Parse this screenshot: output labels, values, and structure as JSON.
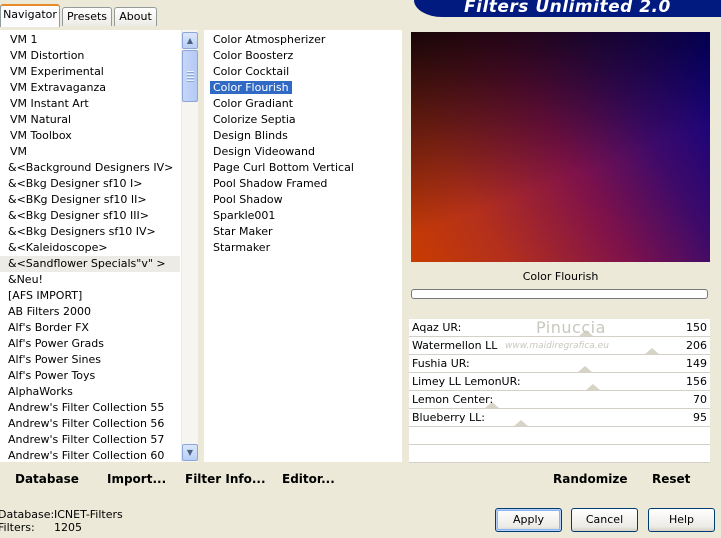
{
  "window": {
    "title": "Filters Unlimited 2.0"
  },
  "tabs": [
    {
      "label": "Navigator",
      "active": true
    },
    {
      "label": "Presets",
      "active": false
    },
    {
      "label": "About",
      "active": false
    }
  ],
  "categories": [
    "VM 1",
    "VM Distortion",
    "VM Experimental",
    "VM Extravaganza",
    "VM Instant Art",
    "VM Natural",
    "VM Toolbox",
    "VM",
    "&<Background Designers IV>",
    "&<Bkg Designer sf10 I>",
    "&<BKg Designer sf10 II>",
    "&<Bkg Designer sf10 III>",
    "&<Bkg Designers sf10 IV>",
    "&<Kaleidoscope>",
    "&<Sandflower Specials\"v\" >",
    "&Neu!",
    "[AFS IMPORT]",
    "AB Filters 2000",
    "Alf's Border FX",
    "Alf's Power Grads",
    "Alf's Power Sines",
    "Alf's Power Toys",
    "AlphaWorks",
    "Andrew's Filter Collection 55",
    "Andrew's Filter Collection 56",
    "Andrew's Filter Collection 57",
    "Andrew's Filter Collection 60"
  ],
  "selected_category": "&<Sandflower Specials\"v\" >",
  "filters": [
    "Color Atmospherizer",
    "Color Boosterz",
    "Color Cocktail",
    "Color Flourish",
    "Color Gradiant",
    "Colorize Septia",
    "Design Blinds",
    "Design Videowand",
    "Page Curl Bottom Vertical",
    "Pool Shadow Framed",
    "Pool Shadow",
    "Sparkle001",
    "Star Maker",
    "Starmaker"
  ],
  "selected_filter": "Color Flourish",
  "preview": {
    "filter_name": "Color Flourish"
  },
  "params": [
    {
      "label": "Aqaz UR:",
      "value": "150",
      "fraction": 0.588
    },
    {
      "label": "Watermellon LL",
      "value": "206",
      "fraction": 0.808
    },
    {
      "label": "Fushia UR:",
      "value": "149",
      "fraction": 0.584
    },
    {
      "label": "Limey LL LemonUR:",
      "value": "156",
      "fraction": 0.612
    },
    {
      "label": "Lemon Center:",
      "value": "70",
      "fraction": 0.275
    },
    {
      "label": "Blueberry LL:",
      "value": "95",
      "fraction": 0.373
    }
  ],
  "watermark": {
    "line1": "Pinuccia",
    "line2": "www.maidiregrafica.eu"
  },
  "toolbar": {
    "database": "Database",
    "import": "Import...",
    "filter_info": "Filter Info...",
    "editor": "Editor...",
    "randomize": "Randomize",
    "reset": "Reset"
  },
  "status": {
    "database_label": "Database:",
    "database_value": "ICNET-Filters",
    "filters_label": "Filters:",
    "filters_value": "1205"
  },
  "buttons": {
    "apply": "Apply",
    "cancel": "Cancel",
    "help": "Help"
  },
  "colors": {
    "selection": "#316ac5",
    "title_banner": "#001a80",
    "dialog_bg": "#ece9d8"
  }
}
